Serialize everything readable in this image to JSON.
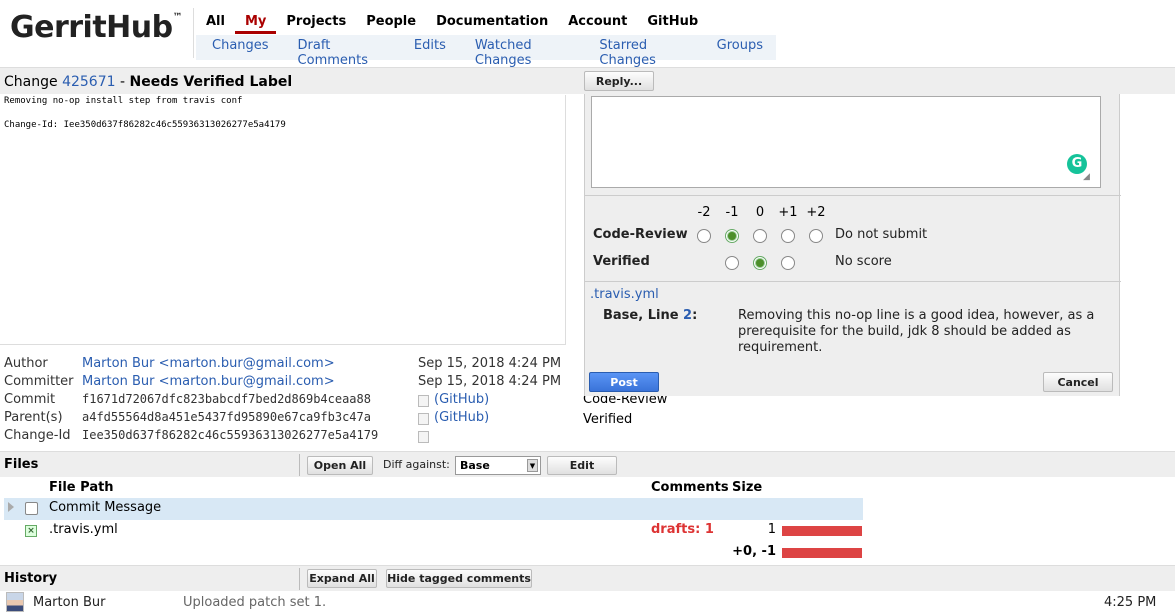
{
  "header": {
    "logo": "GerritHub",
    "logo_tm": "™",
    "primary_menu": [
      "All",
      "My",
      "Projects",
      "People",
      "Documentation",
      "Account",
      "GitHub"
    ],
    "primary_active": "My",
    "secondary_menu": [
      "Changes",
      "Draft Comments",
      "Edits",
      "Watched Changes",
      "Starred Changes",
      "Groups"
    ]
  },
  "change": {
    "prefix": "Change",
    "number": "425671",
    "separator": "-",
    "status": "Needs Verified Label",
    "reply_label": "Reply...",
    "commit_message": {
      "subject": "Removing no-op install step from travis conf",
      "change_id_line": "Change-Id: Iee350d637f86282c46c55936313026277e5a4179"
    },
    "info": {
      "author_label": "Author",
      "author": "Marton Bur <marton.bur@gmail.com>",
      "author_date": "Sep 15, 2018 4:24 PM",
      "committer_label": "Committer",
      "committer": "Marton Bur <marton.bur@gmail.com>",
      "committer_date": "Sep 15, 2018 4:24 PM",
      "commit_label": "Commit",
      "commit": "f1671d72067dfc823babcdf7bed2d869b4ceaa88",
      "commit_link": "(GitHub)",
      "parents_label": "Parent(s)",
      "parent": "a4fd55564d8a451e5437fd95890e67ca9fb3c47a",
      "parent_link": "(GitHub)",
      "changeid_label": "Change-Id",
      "changeid": "Iee350d637f86282c46c55936313026277e5a4179"
    },
    "labels_under": [
      "Code-Review",
      "Verified"
    ]
  },
  "reply_popup": {
    "textarea_value": "",
    "vote_values": [
      "-2",
      "-1",
      "0",
      "+1",
      "+2"
    ],
    "code_review": {
      "label": "Code-Review",
      "selected": "-1",
      "description": "Do not submit"
    },
    "verified": {
      "label": "Verified",
      "selected": "0",
      "description": "No score"
    },
    "draft": {
      "file": ".travis.yml",
      "line_prefix": "Base, Line",
      "line_number": "2",
      "line_suffix": ":",
      "text": "Removing this no-op line is a good idea, however, as a prerequisite for the build, jdk 8 should be added as requirement."
    },
    "post_label": "Post",
    "cancel_label": "Cancel"
  },
  "files": {
    "title": "Files",
    "open_all_label": "Open All",
    "diff_against_label": "Diff against:",
    "diff_against_value": "Base",
    "edit_label": "Edit",
    "columns": {
      "file_path": "File Path",
      "comments": "Comments",
      "size": "Size"
    },
    "rows": [
      {
        "name": "Commit Message",
        "drafts": "",
        "size": "",
        "bar_fraction": 0
      },
      {
        "name": ".travis.yml",
        "drafts": "drafts: 1",
        "size": "1",
        "bar_fraction": 1
      }
    ],
    "total_delta": "+0, -1",
    "total_bar_fraction": 1
  },
  "history": {
    "title": "History",
    "expand_all_label": "Expand All",
    "hide_tagged_label": "Hide tagged comments",
    "entries": [
      {
        "author": "Marton Bur",
        "message": "Uploaded patch set 1.",
        "time": "4:25 PM"
      }
    ]
  },
  "colors": {
    "link": "#2a5db0",
    "accent_red": "#aa0000",
    "bar_red": "#dd4444",
    "post_blue": "#3a73d9"
  }
}
